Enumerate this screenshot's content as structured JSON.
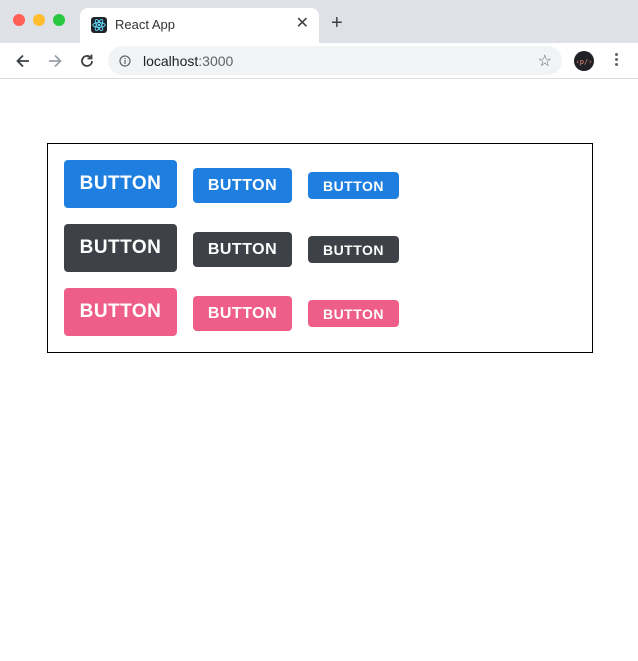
{
  "window": {
    "traffic_lights": [
      "#fe5f57",
      "#febc2e",
      "#28c840"
    ]
  },
  "tab": {
    "title": "React App",
    "close_label": "✕",
    "new_tab_label": "+"
  },
  "address_bar": {
    "host": "localhost",
    "port": ":3000"
  },
  "buttons": {
    "rows": [
      {
        "color": "#1e7fe1",
        "large": "BUTTON",
        "medium": "BUTTON",
        "small": "BUTTON"
      },
      {
        "color": "#3e4248",
        "large": "BUTTON",
        "medium": "BUTTON",
        "small": "BUTTON"
      },
      {
        "color": "#ee5e89",
        "large": "BUTTON",
        "medium": "BUTTON",
        "small": "BUTTON"
      }
    ]
  }
}
